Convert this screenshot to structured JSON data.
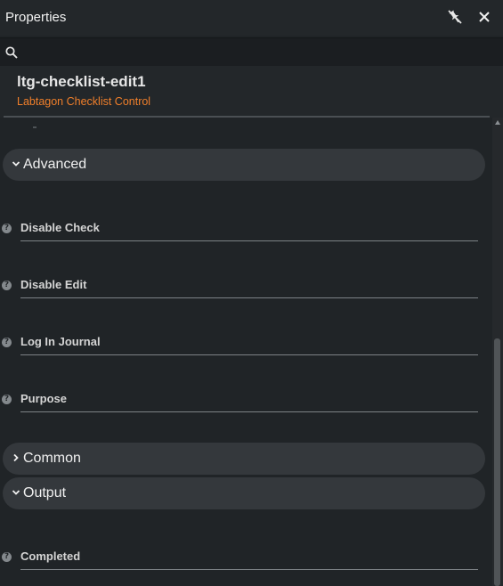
{
  "panel": {
    "title": "Properties",
    "pin_icon": "pin-off-icon",
    "close_icon": "close-icon"
  },
  "search": {
    "icon": "search-icon",
    "value": "",
    "placeholder": ""
  },
  "header": {
    "control_name": "ltg-checklist-edit1",
    "control_type": "Labtagon Checklist Control",
    "accent_color": "#f07f2a"
  },
  "groups": {
    "advanced": {
      "label": "Advanced",
      "expanded": true,
      "properties": [
        {
          "label": "Disable Check"
        },
        {
          "label": "Disable Edit"
        },
        {
          "label": "Log In Journal"
        },
        {
          "label": "Purpose"
        }
      ]
    },
    "common": {
      "label": "Common",
      "expanded": false
    },
    "output": {
      "label": "Output",
      "expanded": true,
      "properties": [
        {
          "label": "Completed"
        }
      ]
    }
  },
  "help_icon": "question-circle-icon"
}
